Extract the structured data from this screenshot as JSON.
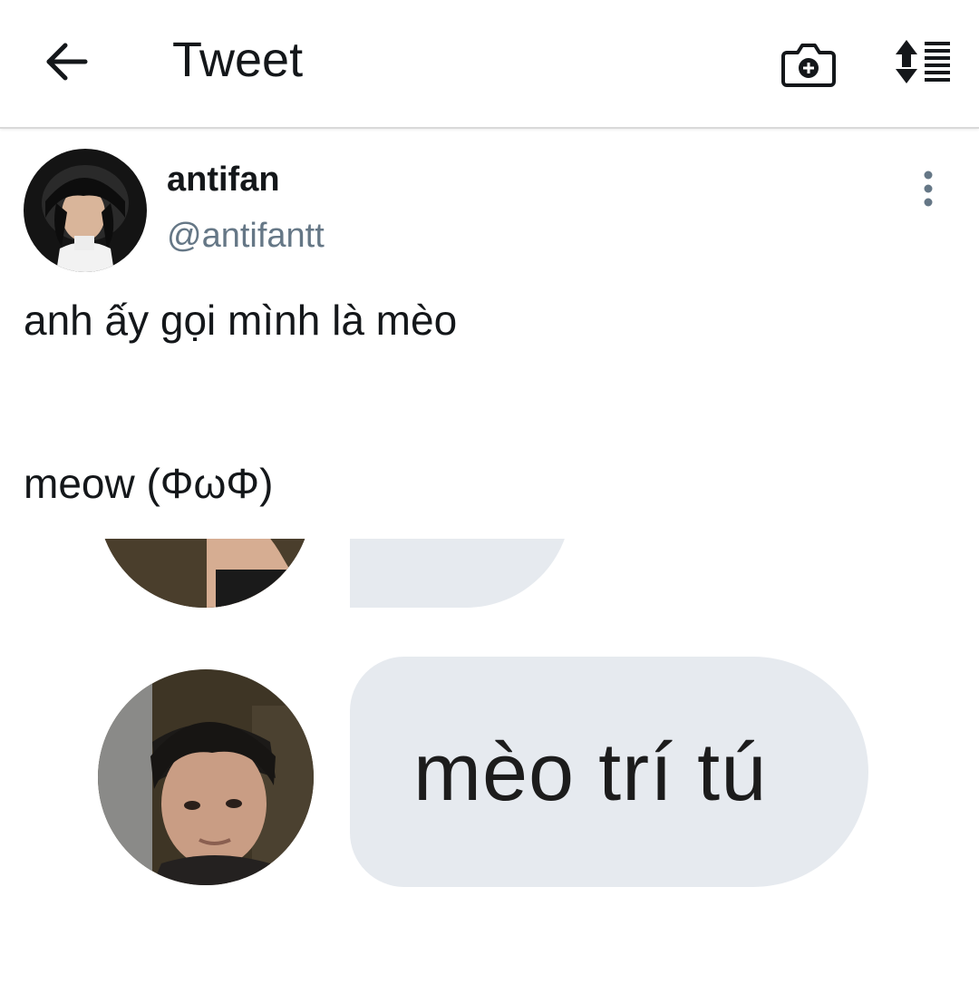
{
  "header": {
    "title": "Tweet",
    "back_icon": "arrow-left-icon",
    "camera_icon": "camera-plus-icon",
    "sort_icon": "sort-list-icon"
  },
  "tweet": {
    "author": {
      "display_name": "antifan",
      "handle": "@antifantt"
    },
    "text_lines": [
      "anh ấy gọi mình là mèo",
      "meow (ΦωΦ)"
    ],
    "more_icon": "more-vertical-icon"
  },
  "media": {
    "message_text": "mèo trí tú",
    "bubble_color": "#e6eaef"
  },
  "colors": {
    "text_primary": "#14171a",
    "text_secondary": "#657786",
    "divider": "#d9d9d9"
  }
}
